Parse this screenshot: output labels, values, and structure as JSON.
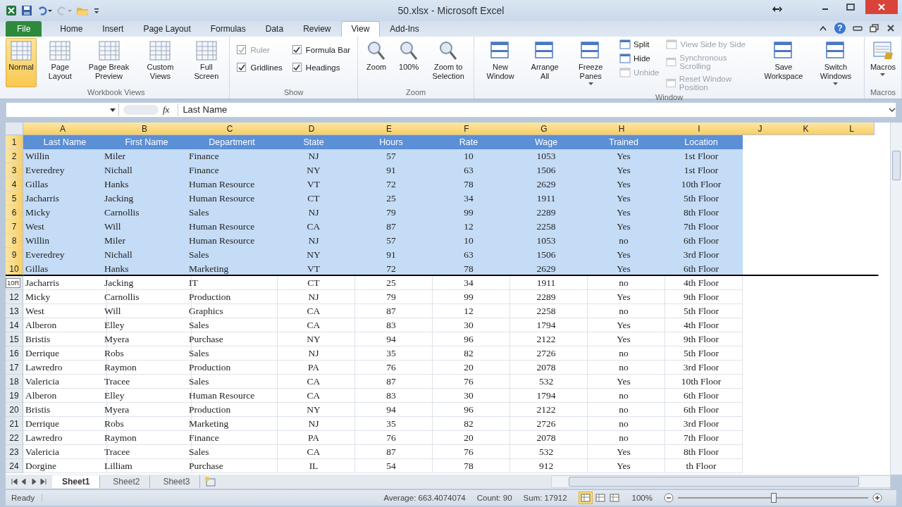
{
  "title_bar": {
    "title": "50.xlsx  -  Microsoft Excel"
  },
  "tabs": [
    {
      "label": "File",
      "kind": "file",
      "selected": false
    },
    {
      "label": "Home",
      "kind": "tab",
      "selected": false
    },
    {
      "label": "Insert",
      "kind": "tab",
      "selected": false
    },
    {
      "label": "Page Layout",
      "kind": "tab",
      "selected": false
    },
    {
      "label": "Formulas",
      "kind": "tab",
      "selected": false
    },
    {
      "label": "Data",
      "kind": "tab",
      "selected": false
    },
    {
      "label": "Review",
      "kind": "tab",
      "selected": false
    },
    {
      "label": "View",
      "kind": "tab",
      "selected": true
    },
    {
      "label": "Add-Ins",
      "kind": "tab",
      "selected": false
    }
  ],
  "help_button": "?",
  "ribbon": {
    "groups": [
      {
        "name": "Workbook Views",
        "items": [
          {
            "kind": "large",
            "label": "Normal",
            "selected": true
          },
          {
            "kind": "large",
            "label": "Page Layout",
            "selected": false
          },
          {
            "kind": "large",
            "label": "Page Break Preview",
            "selected": false
          },
          {
            "kind": "large",
            "label": "Custom Views",
            "selected": false
          },
          {
            "kind": "large",
            "label": "Full Screen",
            "selected": false
          }
        ]
      },
      {
        "name": "Show",
        "items": [
          {
            "kind": "check",
            "label": "Ruler",
            "checked": true,
            "disabled": true
          },
          {
            "kind": "check",
            "label": "Formula Bar",
            "checked": true,
            "disabled": false
          },
          {
            "kind": "check",
            "label": "Gridlines",
            "checked": true,
            "disabled": false
          },
          {
            "kind": "check",
            "label": "Headings",
            "checked": true,
            "disabled": false
          }
        ]
      },
      {
        "name": "Zoom",
        "items": [
          {
            "kind": "large",
            "label": "Zoom",
            "dropdown": false
          },
          {
            "kind": "large",
            "label": "100%",
            "dropdown": false
          },
          {
            "kind": "large",
            "label": "Zoom to Selection",
            "dropdown": false
          }
        ]
      },
      {
        "name": "Window",
        "items": [
          {
            "kind": "large",
            "label": "New Window",
            "dropdown": false
          },
          {
            "kind": "large",
            "label": "Arrange All",
            "dropdown": false
          },
          {
            "kind": "large",
            "label": "Freeze Panes",
            "dropdown": true
          },
          {
            "kind": "small",
            "label": "Split",
            "disabled": false
          },
          {
            "kind": "small",
            "label": "Hide",
            "disabled": false
          },
          {
            "kind": "small",
            "label": "Unhide",
            "disabled": true
          },
          {
            "kind": "small",
            "label": "View Side by Side",
            "disabled": true
          },
          {
            "kind": "small",
            "label": "Synchronous Scrolling",
            "disabled": true
          },
          {
            "kind": "small",
            "label": "Reset Window Position",
            "disabled": true
          },
          {
            "kind": "large",
            "label": "Save Workspace",
            "dropdown": false
          },
          {
            "kind": "large",
            "label": "Switch Windows",
            "dropdown": true
          }
        ]
      },
      {
        "name": "Macros",
        "items": [
          {
            "kind": "large",
            "label": "Macros",
            "dropdown": true
          }
        ]
      }
    ]
  },
  "formula_bar": {
    "function_label": "fx",
    "value": "Last Name"
  },
  "sheet": {
    "columns": [
      {
        "label": "A",
        "selected": true
      },
      {
        "label": "B",
        "selected": true
      },
      {
        "label": "C",
        "selected": true
      },
      {
        "label": "D",
        "selected": true
      },
      {
        "label": "E",
        "selected": true
      },
      {
        "label": "F",
        "selected": true
      },
      {
        "label": "G",
        "selected": true
      },
      {
        "label": "H",
        "selected": true
      },
      {
        "label": "I",
        "selected": true
      },
      {
        "label": "J",
        "selected": true
      },
      {
        "label": "K",
        "selected": true
      },
      {
        "label": "L",
        "selected": true
      }
    ],
    "rows": [
      {
        "num": "1",
        "kind": "header",
        "selected": true,
        "cells": [
          "Last Name",
          "First Name",
          "Department",
          "State",
          "Hours",
          "Rate",
          "Wage",
          "Trained",
          "Location"
        ]
      },
      {
        "num": "2",
        "kind": "data",
        "selected": true,
        "cells": [
          "Willin",
          "Miler",
          "Finance",
          "NJ",
          "57",
          "10",
          "1053",
          "Yes",
          "1st Floor"
        ]
      },
      {
        "num": "3",
        "kind": "data",
        "selected": true,
        "cells": [
          "Everedrey",
          "Nichall",
          "Finance",
          "NY",
          "91",
          "63",
          "1506",
          "Yes",
          "1st Floor"
        ]
      },
      {
        "num": "4",
        "kind": "data",
        "selected": true,
        "cells": [
          "Gillas",
          "Hanks",
          "Human Resource",
          "VT",
          "72",
          "78",
          "2629",
          "Yes",
          "10th Floor"
        ]
      },
      {
        "num": "5",
        "kind": "data",
        "selected": true,
        "cells": [
          "Jacharris",
          "Jacking",
          "Human Resource",
          "CT",
          "25",
          "34",
          "1911",
          "Yes",
          "5th Floor"
        ]
      },
      {
        "num": "6",
        "kind": "data",
        "selected": true,
        "cells": [
          "Micky",
          "Carnollis",
          "Sales",
          "NJ",
          "79",
          "99",
          "2289",
          "Yes",
          "8th Floor"
        ]
      },
      {
        "num": "7",
        "kind": "data",
        "selected": true,
        "cells": [
          "West",
          "Will",
          "Human Resource",
          "CA",
          "87",
          "12",
          "2258",
          "Yes",
          "7th Floor"
        ]
      },
      {
        "num": "8",
        "kind": "data",
        "selected": true,
        "cells": [
          "Willin",
          "Miler",
          "Human Resource",
          "NJ",
          "57",
          "10",
          "1053",
          "no",
          "6th Floor"
        ]
      },
      {
        "num": "9",
        "kind": "data",
        "selected": true,
        "cells": [
          "Everedrey",
          "Nichall",
          "Sales",
          "NY",
          "91",
          "63",
          "1506",
          "Yes",
          "3rd Floor"
        ]
      },
      {
        "num": "10",
        "kind": "data",
        "selected": true,
        "cells": [
          "Gillas",
          "Hanks",
          "Marketing",
          "VT",
          "72",
          "78",
          "2629",
          "Yes",
          "6th Floor"
        ]
      },
      {
        "tooltip": "10R",
        "kind": "data",
        "selected": false,
        "cells": [
          "Jacharris",
          "Jacking",
          "IT",
          "CT",
          "25",
          "34",
          "1911",
          "no",
          "4th Floor"
        ]
      },
      {
        "num": "12",
        "kind": "data",
        "selected": false,
        "cells": [
          "Micky",
          "Carnollis",
          "Production",
          "NJ",
          "79",
          "99",
          "2289",
          "Yes",
          "9th Floor"
        ]
      },
      {
        "num": "13",
        "kind": "data",
        "selected": false,
        "cells": [
          "West",
          "Will",
          "Graphics",
          "CA",
          "87",
          "12",
          "2258",
          "no",
          "5th Floor"
        ]
      },
      {
        "num": "14",
        "kind": "data",
        "selected": false,
        "cells": [
          "Alberon",
          "Elley",
          "Sales",
          "CA",
          "83",
          "30",
          "1794",
          "Yes",
          "4th Floor"
        ]
      },
      {
        "num": "15",
        "kind": "data",
        "selected": false,
        "cells": [
          "Bristis",
          "Myera",
          "Purchase",
          "NY",
          "94",
          "96",
          "2122",
          "Yes",
          "9th Floor"
        ]
      },
      {
        "num": "16",
        "kind": "data",
        "selected": false,
        "cells": [
          "Derrique",
          "Robs",
          "Sales",
          "NJ",
          "35",
          "82",
          "2726",
          "no",
          "5th Floor"
        ]
      },
      {
        "num": "17",
        "kind": "data",
        "selected": false,
        "cells": [
          "Lawredro",
          "Raymon",
          "Production",
          "PA",
          "76",
          "20",
          "2078",
          "no",
          "3rd Floor"
        ]
      },
      {
        "num": "18",
        "kind": "data",
        "selected": false,
        "cells": [
          "Valericia",
          "Tracee",
          "Sales",
          "CA",
          "87",
          "76",
          "532",
          "Yes",
          "10th Floor"
        ]
      },
      {
        "num": "19",
        "kind": "data",
        "selected": false,
        "cells": [
          "Alberon",
          "Elley",
          "Human Resource",
          "CA",
          "83",
          "30",
          "1794",
          "no",
          "6th Floor"
        ]
      },
      {
        "num": "20",
        "kind": "data",
        "selected": false,
        "cells": [
          "Bristis",
          "Myera",
          "Production",
          "NY",
          "94",
          "96",
          "2122",
          "no",
          "6th Floor"
        ]
      },
      {
        "num": "21",
        "kind": "data",
        "selected": false,
        "cells": [
          "Derrique",
          "Robs",
          "Marketing",
          "NJ",
          "35",
          "82",
          "2726",
          "no",
          "3rd Floor"
        ]
      },
      {
        "num": "22",
        "kind": "data",
        "selected": false,
        "cells": [
          "Lawredro",
          "Raymon",
          "Finance",
          "PA",
          "76",
          "20",
          "2078",
          "no",
          "7th Floor"
        ]
      },
      {
        "num": "23",
        "kind": "data",
        "selected": false,
        "cells": [
          "Valericia",
          "Tracee",
          "Sales",
          "CA",
          "87",
          "76",
          "532",
          "Yes",
          "8th Floor"
        ]
      },
      {
        "num": "24",
        "kind": "data",
        "selected": false,
        "cells": [
          "Dorgine",
          "Lilliam",
          "Purchase",
          "IL",
          "54",
          "78",
          "912",
          "Yes",
          "th Floor"
        ]
      }
    ]
  },
  "sheet_tabs": [
    {
      "label": "Sheet1",
      "selected": true
    },
    {
      "label": "Sheet2",
      "selected": false
    },
    {
      "label": "Sheet3",
      "selected": false
    }
  ],
  "status_bar": {
    "mode": "Ready",
    "average": "Average: 663.4074074",
    "count": "Count: 90",
    "sum": "Sum: 17912",
    "views": [
      {
        "selected": true
      },
      {
        "selected": false
      },
      {
        "selected": false
      }
    ],
    "zoom": "100%",
    "zoom_slider": {
      "level": 0.5
    }
  }
}
